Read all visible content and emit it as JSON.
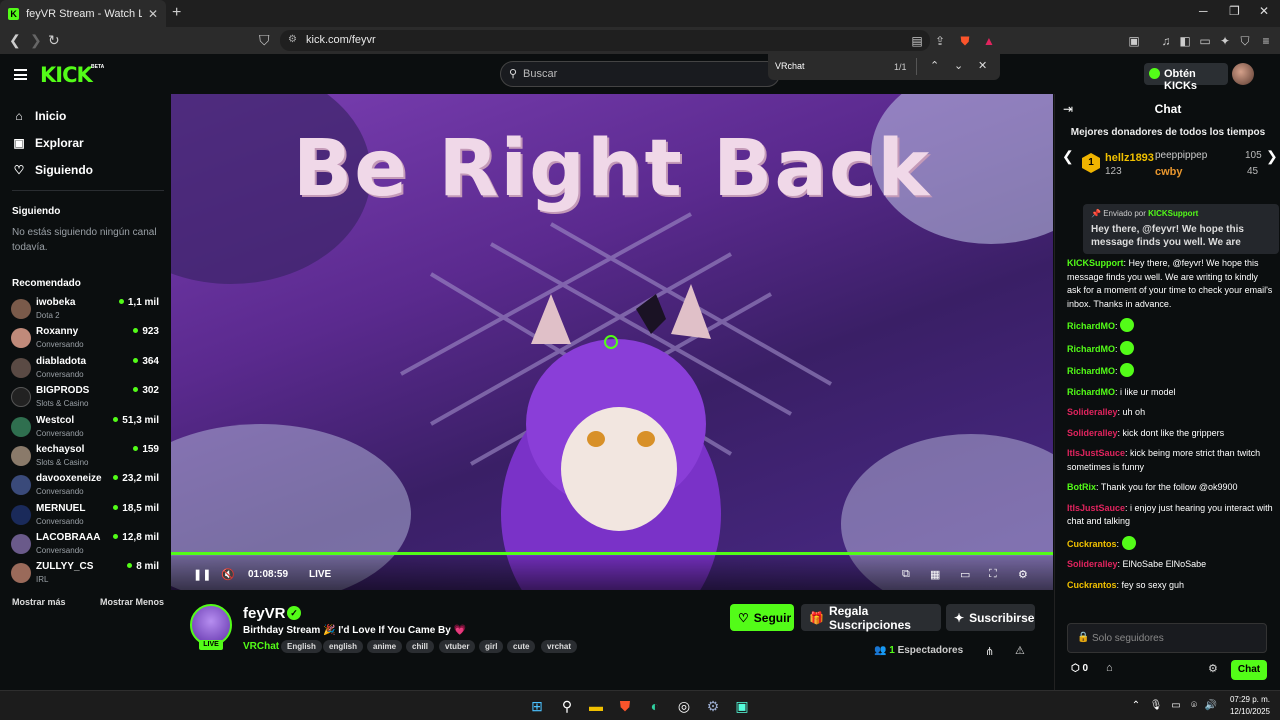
{
  "browser": {
    "tab_title": "feyVR Stream - Watch Live on Kick",
    "tab_close": "✕",
    "new_tab": "+",
    "url": "kick.com/feyvr",
    "find": {
      "query": "VRchat",
      "count": "1/1"
    }
  },
  "header": {
    "logo": "KICK",
    "beta": "BETA",
    "search_placeholder": "Buscar",
    "get_kicks": "Obtén KICKs"
  },
  "sidebar": {
    "nav": [
      {
        "label": "Inicio",
        "icon": "home-icon"
      },
      {
        "label": "Explorar",
        "icon": "compass-icon"
      },
      {
        "label": "Siguiendo",
        "icon": "heart-icon"
      }
    ],
    "following_heading": "Siguiendo",
    "following_empty": "No estás siguiendo ningún canal todavía.",
    "recommended_heading": "Recomendado",
    "recommended": [
      {
        "name": "iwobeka",
        "category": "Dota 2",
        "viewers": "1,1 mil"
      },
      {
        "name": "Roxanny",
        "category": "Conversando",
        "viewers": "923"
      },
      {
        "name": "diabladota",
        "category": "Conversando",
        "viewers": "364"
      },
      {
        "name": "BIGPRODS",
        "category": "Slots & Casino",
        "viewers": "302"
      },
      {
        "name": "Westcol",
        "category": "Conversando",
        "viewers": "51,3 mil"
      },
      {
        "name": "kechaysol",
        "category": "Slots & Casino",
        "viewers": "159"
      },
      {
        "name": "davooxeneize",
        "category": "Conversando",
        "viewers": "23,2 mil"
      },
      {
        "name": "MERNUEL",
        "category": "Conversando",
        "viewers": "18,5 mil"
      },
      {
        "name": "LACOBRAAA",
        "category": "Conversando",
        "viewers": "12,8 mil"
      },
      {
        "name": "ZULLYY_CS",
        "category": "IRL",
        "viewers": "8 mil"
      }
    ],
    "show_more": "Mostrar más",
    "show_less": "Mostrar Menos"
  },
  "video": {
    "overlay_text": "Be Right Back",
    "time": "01:08:59",
    "live_label": "LIVE"
  },
  "channel": {
    "name": "feyVR",
    "live_badge": "LIVE",
    "title": "Birthday Stream 🎉 I'd Love If You Came By 💗",
    "category": "VRChat",
    "tags": [
      "English",
      "english",
      "anime",
      "chill",
      "vtuber",
      "girl",
      "cute",
      "vrchat"
    ],
    "follow": "Seguir",
    "gift": "Regala Suscripciones",
    "subscribe": "Suscribirse",
    "viewers_count": "1",
    "viewers_label": "Espectadores"
  },
  "chat": {
    "title": "Chat",
    "donors_heading": "Mejores donadores de todos los tiempos",
    "donors": [
      {
        "name": "hellz1893",
        "value": "123",
        "rank": "1"
      },
      {
        "name": "peeppippep",
        "value": "105"
      },
      {
        "name": "cwby",
        "value": "45"
      }
    ],
    "pinned_by_label": "Enviado por",
    "pinned_by": "KICKSupport",
    "pinned_text": "Hey there, @feyvr! We hope this message finds you well. We are writing...",
    "messages": [
      {
        "user": "KICKSupport",
        "color": "#53fc18",
        "text": "Hey there, @feyvr! We hope this message finds you well. We are writing to kindly ask for a moment of your time to check your email's inbox. Thanks in advance."
      },
      {
        "user": "RichardMO",
        "color": "#53fc18",
        "text": ""
      },
      {
        "user": "RichardMO",
        "color": "#53fc18",
        "text": ""
      },
      {
        "user": "RichardMO",
        "color": "#53fc18",
        "text": ""
      },
      {
        "user": "RichardMO",
        "color": "#53fc18",
        "text": "i like ur model"
      },
      {
        "user": "Solideralley",
        "color": "#e0245e",
        "text": "uh oh"
      },
      {
        "user": "Solideralley",
        "color": "#e0245e",
        "text": "kick dont like the grippers"
      },
      {
        "user": "ItIsJustSauce",
        "color": "#e0245e",
        "text": "kick being more strict than twitch sometimes is funny"
      },
      {
        "user": "BotRix",
        "color": "#53fc18",
        "text": "Thank you for the follow @ok9900"
      },
      {
        "user": "ItIsJustSauce",
        "color": "#e0245e",
        "text": "i enjoy just hearing you interact with chat and talking"
      },
      {
        "user": "Cuckrantos",
        "color": "#f0c000",
        "text": ""
      },
      {
        "user": "Solideralley",
        "color": "#e0245e",
        "text": "ElNoSabe ElNoSabe"
      },
      {
        "user": "Cuckrantos",
        "color": "#f0c000",
        "text": "fey so sexy guh"
      }
    ],
    "input_placeholder": "Solo seguidores",
    "kicks_count": "0",
    "send": "Chat"
  },
  "taskbar": {
    "time": "07:29 p. m.",
    "date": "12/10/2025"
  },
  "colors": {
    "accent": "#53fc18",
    "bg": "#0b0e0f"
  }
}
